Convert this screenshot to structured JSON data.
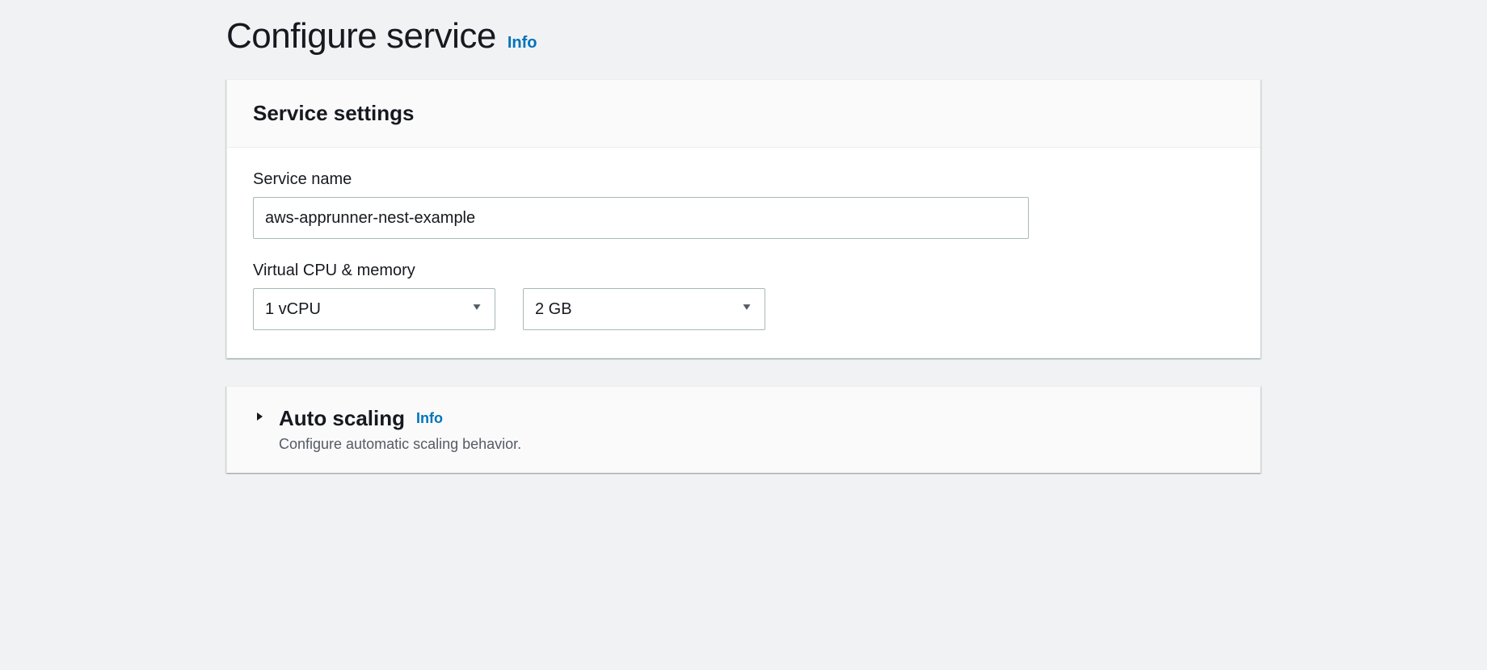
{
  "header": {
    "title": "Configure service",
    "info_label": "Info"
  },
  "service_settings": {
    "panel_title": "Service settings",
    "service_name_label": "Service name",
    "service_name_value": "aws-apprunner-nest-example",
    "cpu_memory_label": "Virtual CPU & memory",
    "cpu_value": "1 vCPU",
    "memory_value": "2 GB"
  },
  "auto_scaling": {
    "title": "Auto scaling",
    "info_label": "Info",
    "description": "Configure automatic scaling behavior."
  }
}
